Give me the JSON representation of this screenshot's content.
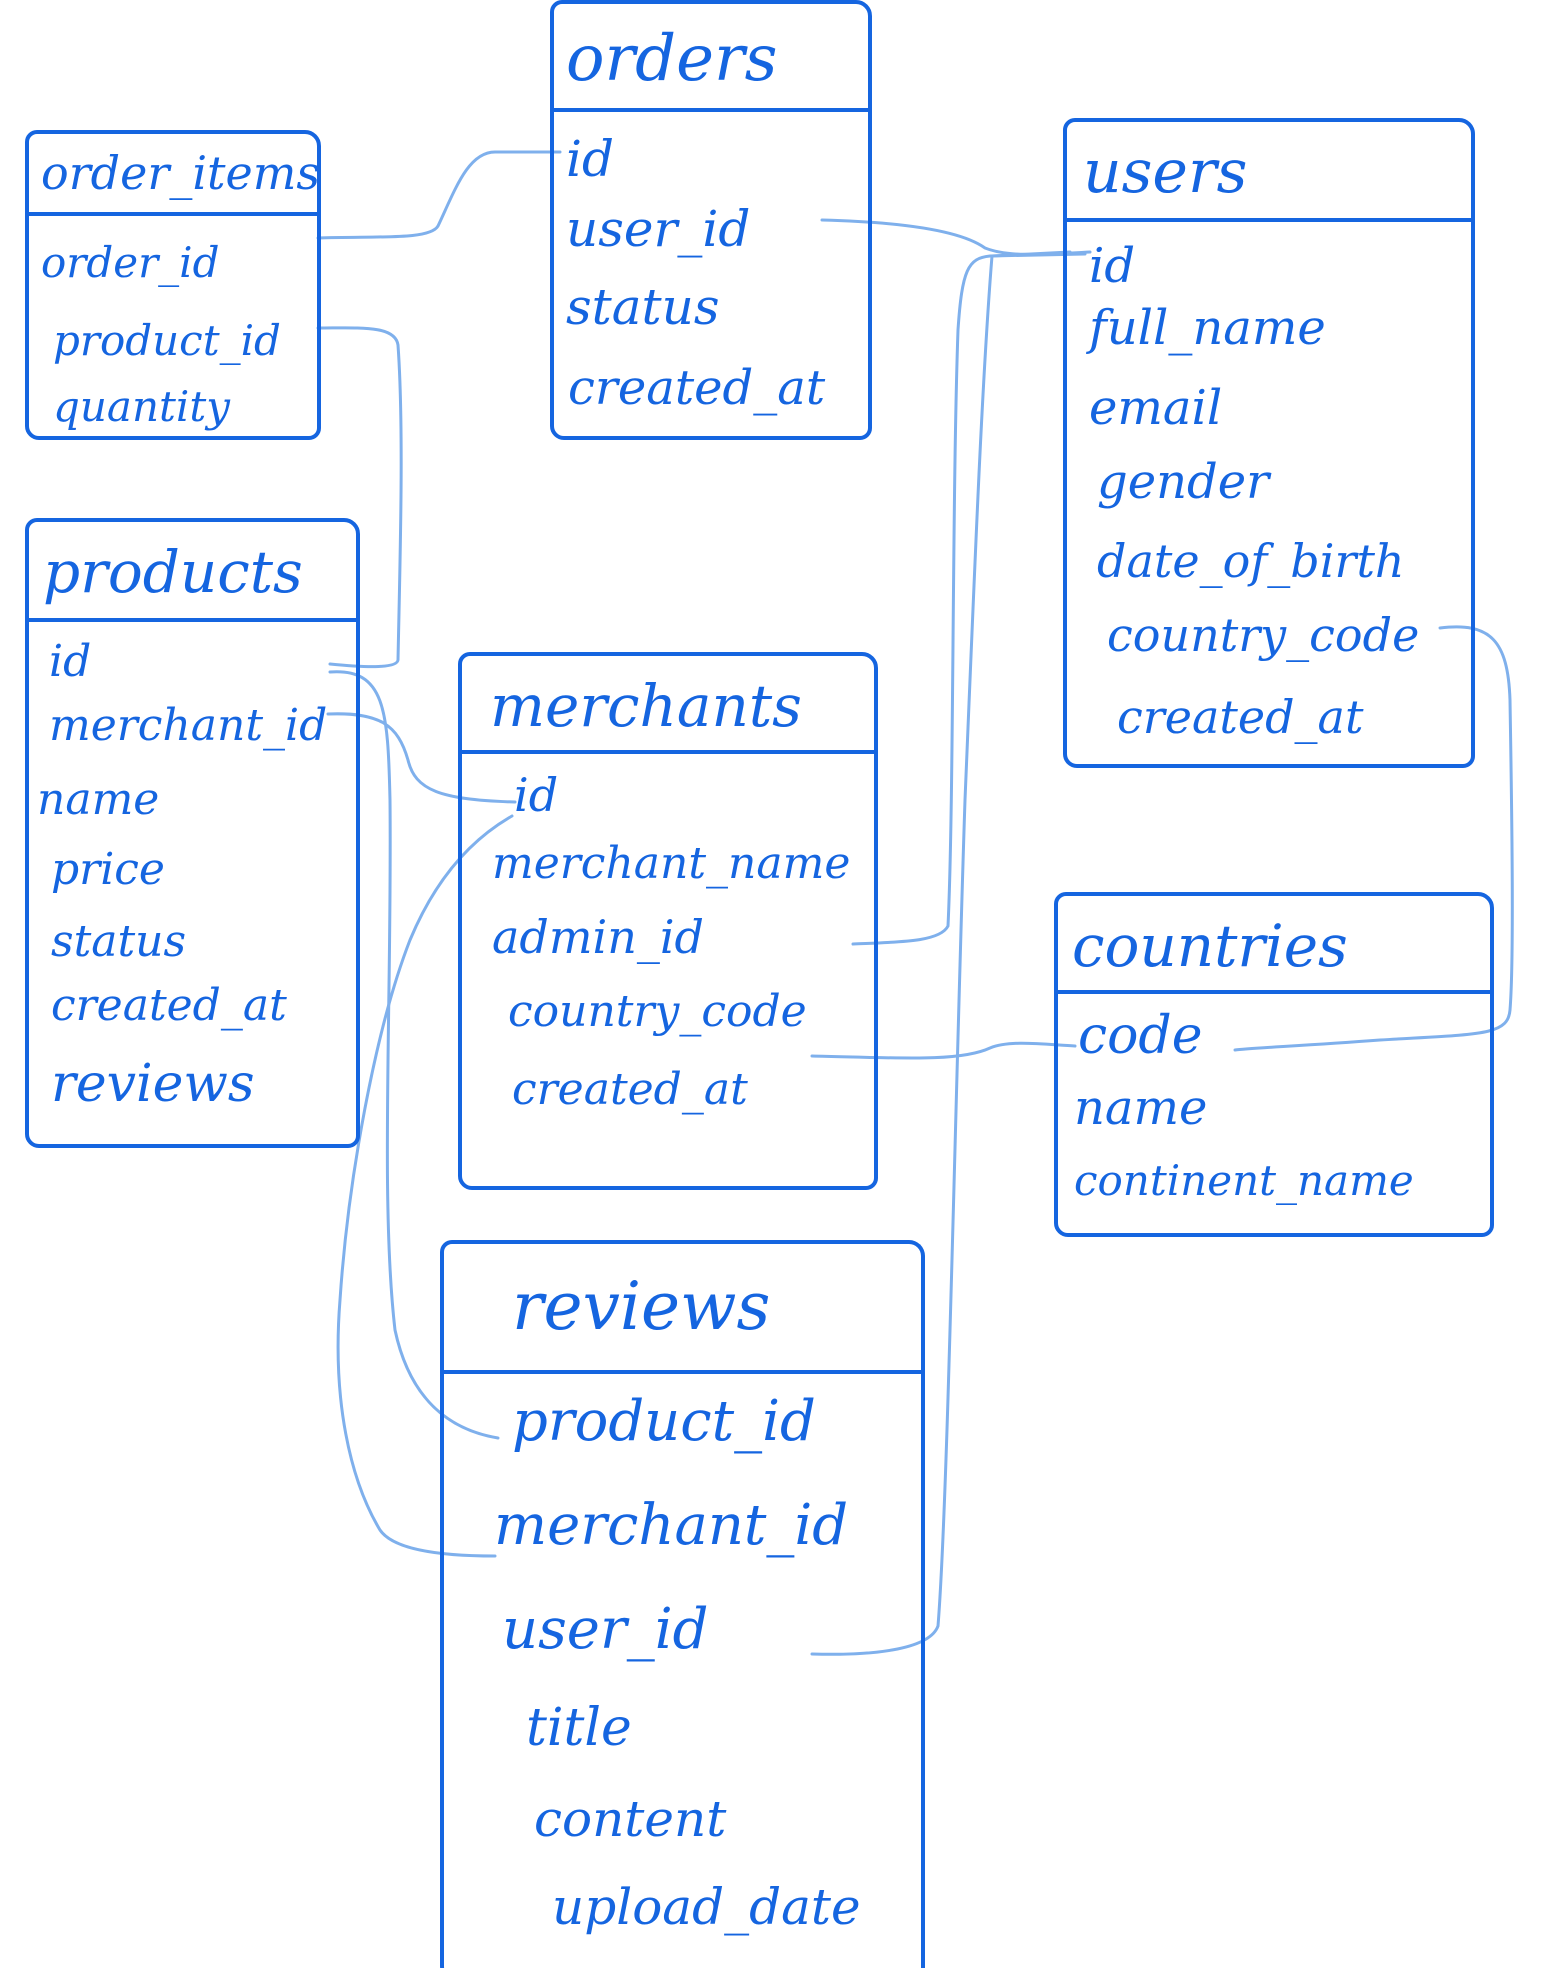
{
  "colors": {
    "ink": "#1565e0",
    "connector": "#7fb0ec",
    "background": "#ffffff"
  },
  "tables": {
    "orders": {
      "title": "orders",
      "fields": [
        "id",
        "user_id",
        "status",
        "created_at"
      ]
    },
    "order_items": {
      "title": "order_items",
      "fields": [
        "order_id",
        "product_id",
        "quantity"
      ]
    },
    "users": {
      "title": "users",
      "fields": [
        "id",
        "full_name",
        "email",
        "gender",
        "date_of_birth",
        "country_code",
        "created_at"
      ]
    },
    "products": {
      "title": "products",
      "fields": [
        "id",
        "merchant_id",
        "name",
        "price",
        "status",
        "created_at",
        "reviews"
      ]
    },
    "merchants": {
      "title": "merchants",
      "fields": [
        "id",
        "merchant_name",
        "admin_id",
        "country_code",
        "created_at"
      ]
    },
    "countries": {
      "title": "countries",
      "fields": [
        "code",
        "name",
        "continent_name"
      ]
    },
    "reviews": {
      "title": "reviews",
      "fields": [
        "product_id",
        "merchant_id",
        "user_id",
        "title",
        "content",
        "upload_date"
      ]
    }
  },
  "relations": [
    {
      "from": "order_items.order_id",
      "to": "orders.id"
    },
    {
      "from": "order_items.product_id",
      "to": "products.id"
    },
    {
      "from": "orders.user_id",
      "to": "users.id"
    },
    {
      "from": "products.merchant_id",
      "to": "merchants.id"
    },
    {
      "from": "products.id",
      "to": "reviews.product_id"
    },
    {
      "from": "merchants.id",
      "to": "reviews.merchant_id"
    },
    {
      "from": "merchants.admin_id",
      "to": "users.id"
    },
    {
      "from": "merchants.country_code",
      "to": "countries.code"
    },
    {
      "from": "users.country_code",
      "to": "countries.code"
    },
    {
      "from": "reviews.user_id",
      "to": "users.id"
    }
  ]
}
